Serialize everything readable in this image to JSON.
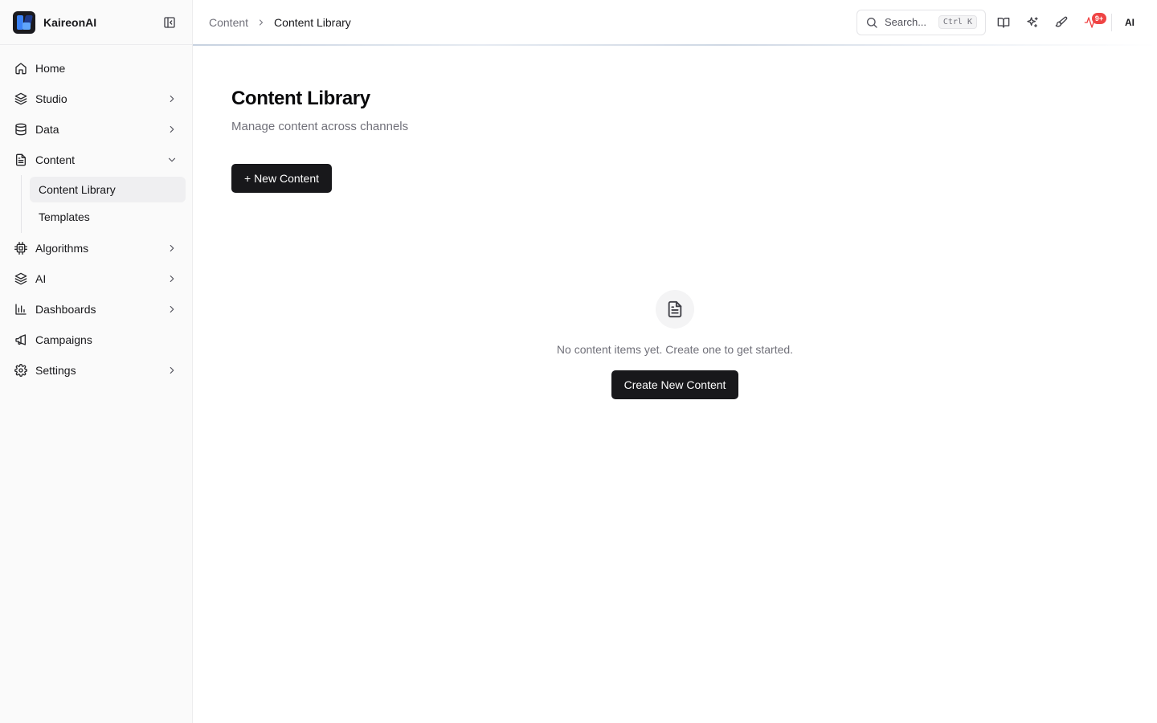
{
  "brand": {
    "name": "KaireonAI"
  },
  "sidebar": {
    "items": [
      {
        "label": "Home",
        "icon": "home-icon",
        "has_chevron": false
      },
      {
        "label": "Studio",
        "icon": "layers-icon",
        "has_chevron": true
      },
      {
        "label": "Data",
        "icon": "database-icon",
        "has_chevron": true
      },
      {
        "label": "Content",
        "icon": "document-icon",
        "expanded": true
      },
      {
        "label": "Algorithms",
        "icon": "cpu-icon",
        "has_chevron": true
      },
      {
        "label": "AI",
        "icon": "layers-icon",
        "has_chevron": true
      },
      {
        "label": "Dashboards",
        "icon": "bar-chart-icon",
        "has_chevron": true
      },
      {
        "label": "Campaigns",
        "icon": "megaphone-icon",
        "has_chevron": false
      },
      {
        "label": "Settings",
        "icon": "gear-icon",
        "has_chevron": true
      }
    ],
    "content_sub": [
      {
        "label": "Content Library",
        "active": true
      },
      {
        "label": "Templates",
        "active": false
      }
    ]
  },
  "topbar": {
    "breadcrumb_parent": "Content",
    "breadcrumb_current": "Content Library",
    "search_placeholder": "Search...",
    "search_shortcut": "Ctrl K",
    "notification_badge": "9+",
    "avatar_initials": "AI"
  },
  "main": {
    "title": "Content Library",
    "subtitle": "Manage content across channels",
    "new_button": "+ New Content",
    "empty_message": "No content items yet. Create one to get started.",
    "empty_button": "Create New Content"
  },
  "colors": {
    "primary": "#18181b",
    "sidebar_bg": "#fafafa",
    "badge": "#ef4444"
  }
}
